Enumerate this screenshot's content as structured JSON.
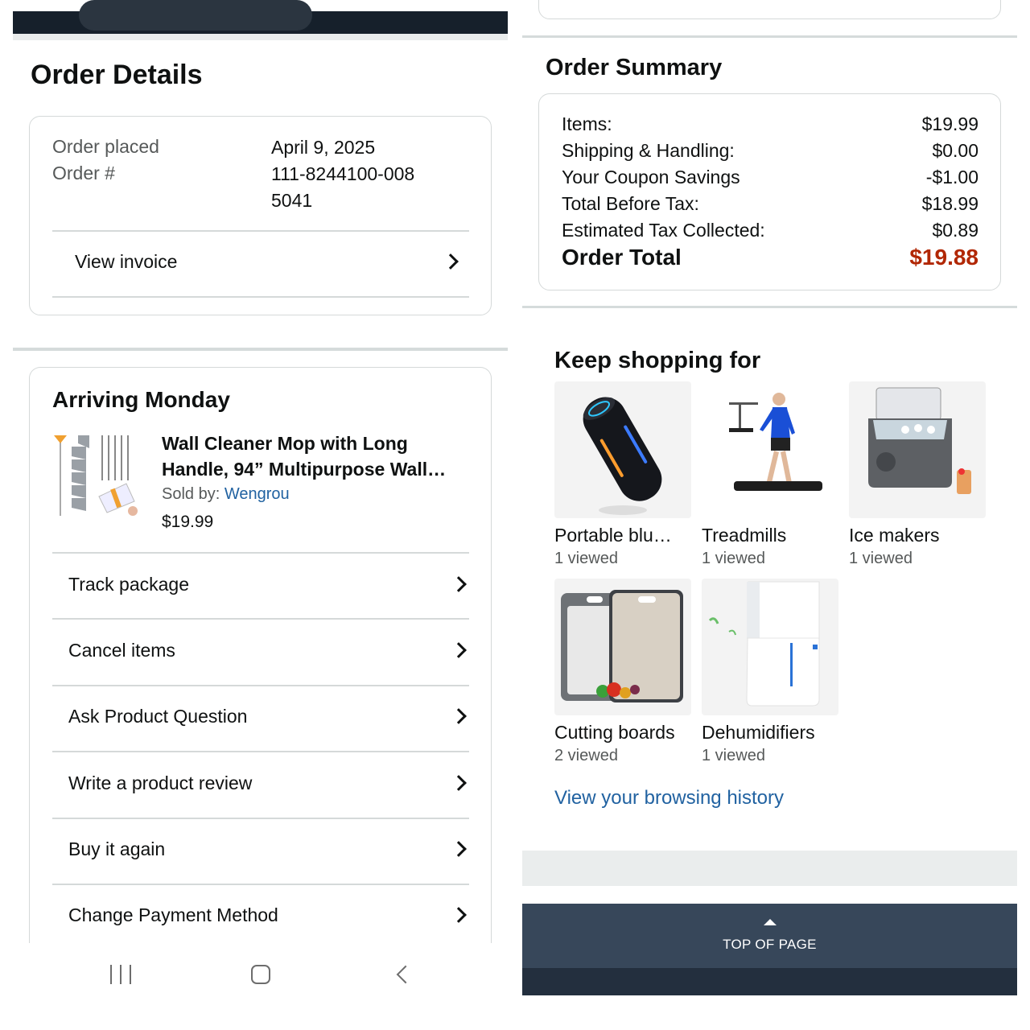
{
  "order_details": {
    "title": "Order Details",
    "order_placed_label": "Order placed",
    "order_placed_value": "April 9, 2025",
    "order_number_label": "Order #",
    "order_number_value": "111-8244100-0085041",
    "view_invoice": "View invoice"
  },
  "shipment": {
    "title": "Arriving Monday",
    "product_title": "Wall Cleaner Mop with Long Handle, 94” Multipurpose Wall…",
    "sold_by_label": "Sold by: ",
    "seller": "Wengrou",
    "price": "$19.99",
    "actions": [
      "Track package",
      "Cancel items",
      "Ask Product Question",
      "Write a product review",
      "Buy it again",
      "Change Payment Method"
    ]
  },
  "order_summary": {
    "title": "Order Summary",
    "rows": [
      {
        "label": "Items:",
        "value": "$19.99"
      },
      {
        "label": "Shipping & Handling:",
        "value": "$0.00"
      },
      {
        "label": "Your Coupon Savings",
        "value": "-$1.00"
      },
      {
        "label": "Total Before Tax:",
        "value": "$18.99"
      },
      {
        "label": "Estimated Tax Collected:",
        "value": "$0.89"
      }
    ],
    "total_label": "Order Total",
    "total_value": "$19.88",
    "total_color": "#b12704"
  },
  "keep_shopping": {
    "title": "Keep shopping for",
    "items": [
      {
        "name": "Portable blu…",
        "views": "1 viewed",
        "icon": "speaker-icon"
      },
      {
        "name": "Treadmills",
        "views": "1 viewed",
        "icon": "treadmill-icon"
      },
      {
        "name": "Ice makers",
        "views": "1 viewed",
        "icon": "ice-maker-icon"
      },
      {
        "name": "Cutting boards",
        "views": "2 viewed",
        "icon": "cutting-board-icon"
      },
      {
        "name": "Dehumidifiers",
        "views": "1 viewed",
        "icon": "dehumidifier-icon"
      }
    ],
    "history_link": "View your browsing history"
  },
  "footer": {
    "top_of_page": "TOP OF PAGE"
  },
  "colors": {
    "link": "#2162a1",
    "footer_nav": "#37475a",
    "footer_dark": "#232f3e",
    "price_red": "#b12704"
  }
}
